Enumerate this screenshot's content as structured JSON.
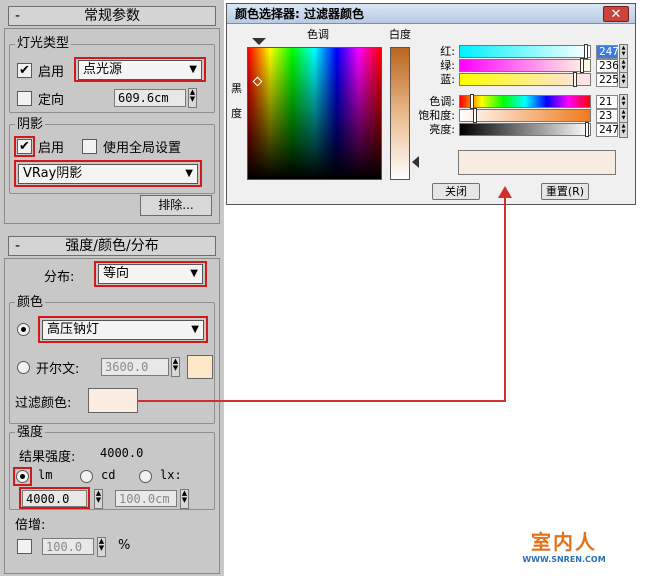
{
  "general": {
    "header_minus": "-",
    "title": "常规参数",
    "light_type_group": "灯光类型",
    "enable_label": "启用",
    "enable_checked": true,
    "light_type_value": "点光源",
    "directional_label": "定向",
    "directional_value": "609.6cm",
    "shadow_group": "阴影",
    "shadow_enable_label": "启用",
    "shadow_enable_checked": true,
    "global_settings_label": "使用全局设置",
    "shadow_type_value": "VRay阴影",
    "exclude_button": "排除..."
  },
  "distribution": {
    "header_minus": "-",
    "title": "强度/颜色/分布",
    "dist_label": "分布:",
    "dist_value": "等向",
    "color_group": "颜色",
    "preset_value": "高压钠灯",
    "kelvin_label": "开尔文:",
    "kelvin_value": "3600.0",
    "kelvin_swatch": "#fde7c9",
    "filter_label": "过滤颜色:",
    "filter_swatch": "#fbece1",
    "intensity_group": "强度",
    "result_label": "结果强度:",
    "result_value": "4000.0",
    "unit_lm": "lm",
    "unit_cd": "cd",
    "unit_lx": "lx:",
    "lm_value": "4000.0",
    "lx_value": "100.0cm",
    "multiplier_label": "倍增:",
    "multiplier_value": "100.0",
    "percent": "%"
  },
  "dialog": {
    "title": "颜色选择器: 过滤器颜色",
    "close_glyph": "✕",
    "hue_label": "色调",
    "whiteness_label": "白度",
    "black_label": "黑",
    "degree_label": "度",
    "sliders": [
      {
        "label": "红:",
        "value": "247"
      },
      {
        "label": "绿:",
        "value": "236"
      },
      {
        "label": "蓝:",
        "value": "225"
      },
      {
        "label": "色调:",
        "value": "21"
      },
      {
        "label": "饱和度:",
        "value": "23"
      },
      {
        "label": "亮度:",
        "value": "247"
      }
    ],
    "preview_color": "#f7ece1",
    "close_button": "关闭",
    "reset_button": "重置(R)"
  },
  "watermark": {
    "brand": "室内人",
    "url": "WWW.SNREN.COM"
  },
  "colors": {
    "highlight": "#d01b1b",
    "arrow": "#d32f2f",
    "panel": "#c8c8c8"
  }
}
